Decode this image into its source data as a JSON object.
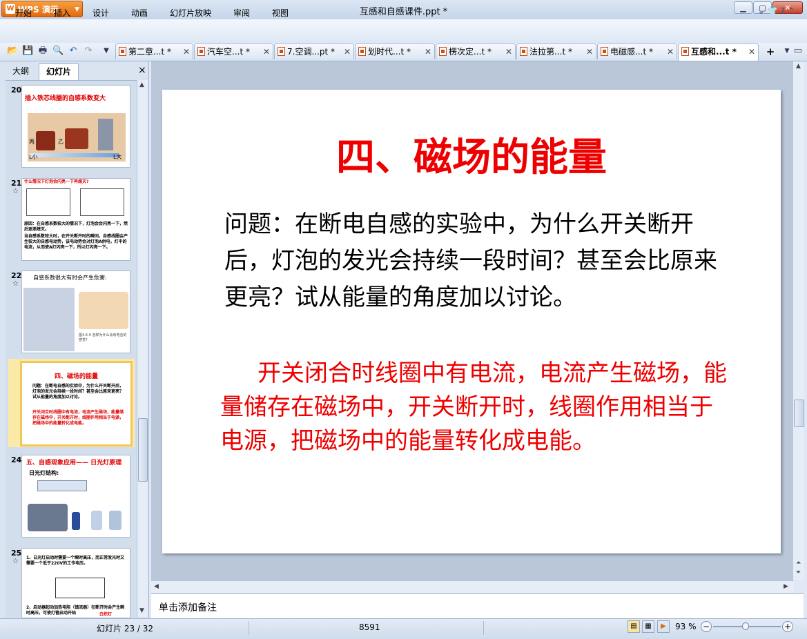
{
  "app": {
    "name": "WPS 演示",
    "window_title": "互感和自感课件.ppt *"
  },
  "menu": [
    "开始",
    "插入",
    "设计",
    "动画",
    "幻灯片放映",
    "审阅",
    "视图"
  ],
  "doc_tabs": [
    {
      "label": "第二章...t *",
      "active": false
    },
    {
      "label": "汽车空...t *",
      "active": false
    },
    {
      "label": "7.空调...pt *",
      "active": false
    },
    {
      "label": "划时代...t *",
      "active": false
    },
    {
      "label": "楞次定...t *",
      "active": false
    },
    {
      "label": "法拉第...t *",
      "active": false
    },
    {
      "label": "电磁感...t *",
      "active": false
    },
    {
      "label": "互感和...t *",
      "active": true
    }
  ],
  "panel": {
    "tab_outline": "大纲",
    "tab_slides": "幻灯片",
    "close": "×"
  },
  "thumbnails": [
    {
      "num": "20",
      "title": "插入铁芯线圈的自感系数变大",
      "labels": [
        "丙",
        "乙",
        "L小",
        "L大"
      ]
    },
    {
      "num": "21",
      "title": "什么情况下灯泡会闪亮一下再熄灭?",
      "text1": "原因：在自感系数较大的情况下，灯泡会会闪亮一下，然后逐渐熄灭。",
      "text2": "当自感系数较大时，在开关断开时的瞬间，自感线圈会产生较大的自感电动势，该电动势会对灯泡A供电，灯中的电流，从而使A灯闪亮一下，所以灯闪亮一下。"
    },
    {
      "num": "22",
      "title": "自感系数很大有时会产生危害:",
      "caption": "图4.6-9 怎样为什么会有电击的感觉?"
    },
    {
      "num": "23",
      "title": "四、磁场的能量",
      "text1": "问题：在断电自感的实验中，为什么开关断开后，灯泡的发光会持续一段时间？甚至会比原来更亮？试从能量的角度加以讨论。",
      "text2": "开关闭合时线圈中有电流，电流产生磁场，能量储存在磁场中，开关断开时，线圈作用相当于电源，把磁场中的能量转化成电能。"
    },
    {
      "num": "24",
      "title": "五、自感现象应用—— 日光灯原理",
      "sub": "日光灯结构:"
    },
    {
      "num": "25",
      "text1": "1、日光灯启动时需要一个瞬时高压，而正常发光时又需要一个低于220V的工作电压。",
      "text2": "2、启动器起动加热电阻（镇流器）在断开时会产生瞬时高压，可使灯管启动开始",
      "tag": "白炽灯"
    }
  ],
  "slide": {
    "title": "四、磁场的能量",
    "question": "问题：在断电自感的实验中，为什么开关断开后，灯泡的发光会持续一段时间？甚至会比原来更亮？试从能量的角度加以讨论。",
    "answer": "开关闭合时线圈中有电流，电流产生磁场，能量储存在磁场中，开关断开时，线圈作用相当于电源，把磁场中的能量转化成电能。"
  },
  "notes_placeholder": "单击添加备注",
  "status": {
    "slide_indicator": "幻灯片 23 / 32",
    "number": "8591",
    "zoom": "93 %"
  },
  "zoom_value": 0.48,
  "colors": {
    "accent": "#ee0000",
    "app_orange": "#e9781e",
    "selection": "#f2c75a"
  }
}
